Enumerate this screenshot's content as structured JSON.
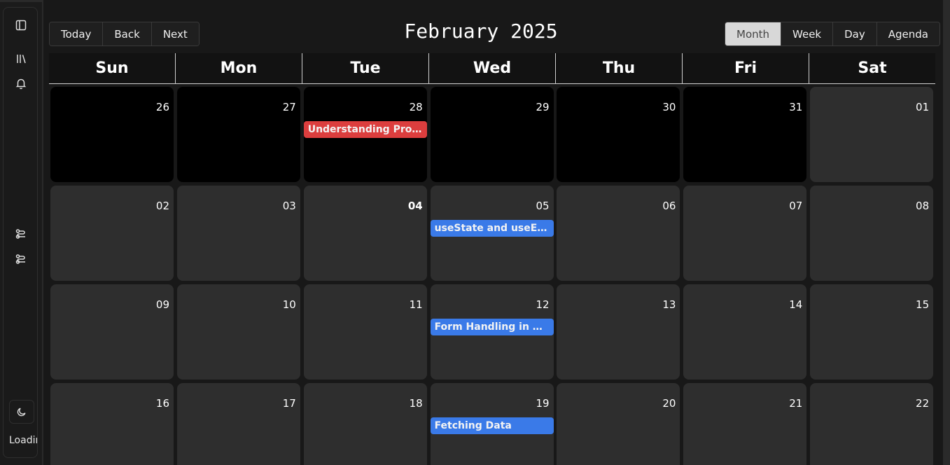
{
  "sidebar": {
    "loading_text": "Loading",
    "icons": [
      "panel-toggle-icon",
      "library-icon",
      "bell-icon",
      "route-icon",
      "route-icon",
      "moon-icon"
    ]
  },
  "toolbar": {
    "today_label": "Today",
    "back_label": "Back",
    "next_label": "Next",
    "title": "February 2025",
    "views": [
      {
        "label": "Month",
        "active": true
      },
      {
        "label": "Week",
        "active": false
      },
      {
        "label": "Day",
        "active": false
      },
      {
        "label": "Agenda",
        "active": false
      }
    ]
  },
  "weekdays": [
    "Sun",
    "Mon",
    "Tue",
    "Wed",
    "Thu",
    "Fri",
    "Sat"
  ],
  "weeks": [
    [
      {
        "day": "26",
        "off": true
      },
      {
        "day": "27",
        "off": true
      },
      {
        "day": "28",
        "off": true,
        "event": "Understanding Props",
        "event_color": "#dc3e3e"
      },
      {
        "day": "29",
        "off": true
      },
      {
        "day": "30",
        "off": true
      },
      {
        "day": "31",
        "off": true
      },
      {
        "day": "01",
        "off": false
      }
    ],
    [
      {
        "day": "02",
        "off": false
      },
      {
        "day": "03",
        "off": false
      },
      {
        "day": "04",
        "off": false,
        "today": true
      },
      {
        "day": "05",
        "off": false,
        "event": "useState and useEffect",
        "event_color": "#3a7ae8"
      },
      {
        "day": "06",
        "off": false
      },
      {
        "day": "07",
        "off": false
      },
      {
        "day": "08",
        "off": false
      }
    ],
    [
      {
        "day": "09",
        "off": false
      },
      {
        "day": "10",
        "off": false
      },
      {
        "day": "11",
        "off": false
      },
      {
        "day": "12",
        "off": false,
        "event": "Form Handling in Re...",
        "event_color": "#3a7ae8"
      },
      {
        "day": "13",
        "off": false
      },
      {
        "day": "14",
        "off": false
      },
      {
        "day": "15",
        "off": false
      }
    ],
    [
      {
        "day": "16",
        "off": false
      },
      {
        "day": "17",
        "off": false
      },
      {
        "day": "18",
        "off": false
      },
      {
        "day": "19",
        "off": false,
        "event": "Fetching Data",
        "event_color": "#3a7ae8"
      },
      {
        "day": "20",
        "off": false
      },
      {
        "day": "21",
        "off": false
      },
      {
        "day": "22",
        "off": false
      }
    ]
  ]
}
